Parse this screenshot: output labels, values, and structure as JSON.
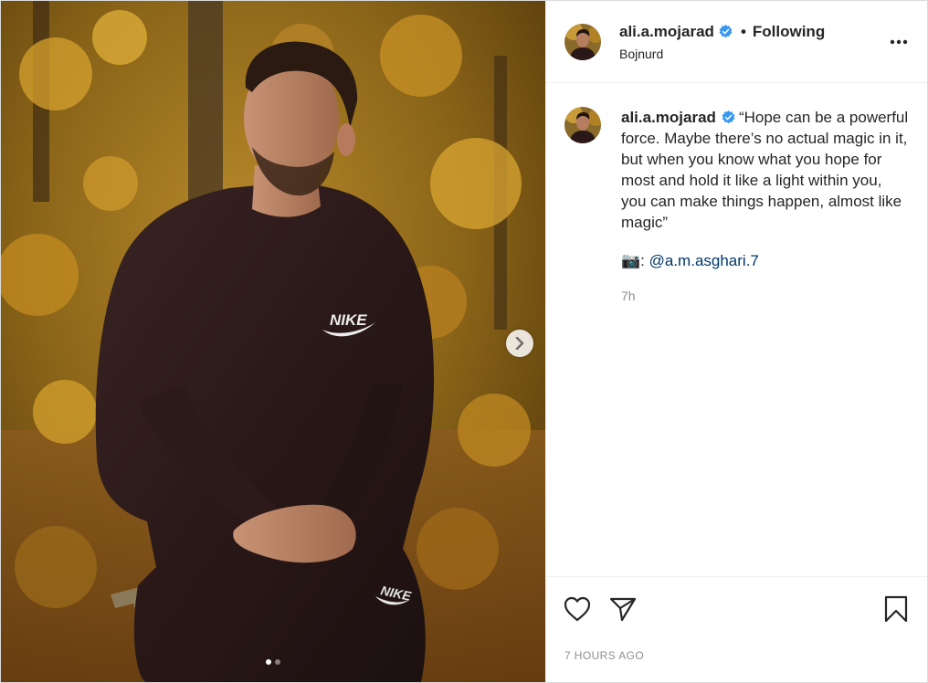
{
  "post": {
    "media": {
      "slide_count": 2,
      "active_slide": 1,
      "sweatshirt_brand": "NIKE"
    },
    "header": {
      "username": "ali.a.mojarad",
      "separator": "•",
      "follow_state": "Following",
      "location": "Bojnurd",
      "verified": true
    },
    "caption": {
      "username": "ali.a.mojarad",
      "text": "“Hope can be a powerful force. Maybe there’s no actual magic in it, but when you know what you hope for most and hold it like a light within you, you can make things happen, almost like magic”",
      "credit_emoji": "📷",
      "credit_separator": ": ",
      "credit_mention": "@a.m.asghari.7",
      "time_ago": "7h"
    },
    "footer": {
      "timestamp": "7 HOURS AGO"
    },
    "colors": {
      "verified_badge": "#3897f0",
      "mention_link": "#00376b",
      "muted_text": "#8e8e8e",
      "border": "#dbdbdb"
    },
    "icons": [
      "next-arrow-icon",
      "verified-badge-icon",
      "more-options-icon",
      "like-heart-icon",
      "share-direct-icon",
      "save-bookmark-icon",
      "camera-emoji"
    ]
  }
}
